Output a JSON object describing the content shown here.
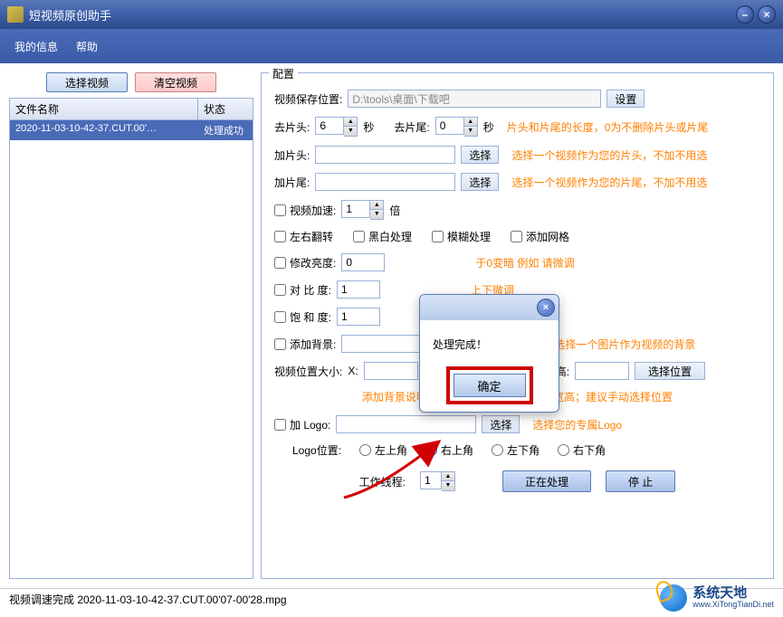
{
  "window": {
    "title": "短视频原创助手"
  },
  "menu": {
    "my_info": "我的信息",
    "help": "帮助"
  },
  "left": {
    "select_video": "选择视频",
    "clear_video": "清空视频",
    "col_name": "文件名称",
    "col_status": "状态",
    "file_name": "2020-11-03-10-42-37.CUT.00'…",
    "file_status": "处理成功"
  },
  "config": {
    "title": "配置",
    "save_path_label": "视频保存位置:",
    "save_path_value": "D:\\tools\\桌面\\下载吧",
    "set_btn": "设置",
    "trim_head_label": "去片头:",
    "trim_head_value": "6",
    "sec_unit": "秒",
    "trim_tail_label": "去片尾:",
    "trim_tail_value": "0",
    "trim_tip": "片头和片尾的长度，0为不删除片头或片尾",
    "add_head_label": "加片头:",
    "add_head_value": "",
    "choose_btn": "选择",
    "add_head_tip": "选择一个视频作为您的片头，不加不用选",
    "add_tail_label": "加片尾:",
    "add_tail_value": "",
    "add_tail_tip": "选择一个视频作为您的片尾，不加不用选",
    "speed_label": "视频加速:",
    "speed_value": "1",
    "speed_unit": "倍",
    "flip_label": "左右翻转",
    "bw_label": "黑白处理",
    "blur_label": "模糊处理",
    "grid_label": "添加网格",
    "brightness_label": "修改亮度:",
    "brightness_value": "0",
    "brightness_tip": "于0变暗  例如 请微调",
    "contrast_label": "对 比  度:",
    "contrast_value": "1",
    "contrast_tip": "上下微调",
    "saturation_label": "饱 和  度:",
    "saturation_value": "1",
    "bg_label": "添加背景:",
    "bg_value": "",
    "bg_tip": "选择一个图片作为视频的背景",
    "pos_label": "视频位置大小:",
    "x_label": "X:",
    "x_value": "",
    "h_label": "高:",
    "h_value": "",
    "pos_btn": "选择位置",
    "pos_tip": "添加背景说明：X和Y                                宽和高代表视频的宽高；建议手动选择位置",
    "logo_label": "加 Logo:",
    "logo_value": "",
    "logo_tip": "选择您的专属Logo",
    "logo_pos_label": "Logo位置:",
    "pos_tl": "左上角",
    "pos_tr": "右上角",
    "pos_bl": "左下角",
    "pos_br": "右下角",
    "threads_label": "工作线程:",
    "threads_value": "1",
    "processing_btn": "正在处理",
    "stop_btn": "停    止"
  },
  "dialog": {
    "message": "处理完成！",
    "ok": "确定"
  },
  "status": {
    "text": "视频调速完成 2020-11-03-10-42-37.CUT.00'07-00'28.mpg"
  },
  "watermark": {
    "cn": "系统天地",
    "en": "www.XiTongTianDi.net"
  }
}
